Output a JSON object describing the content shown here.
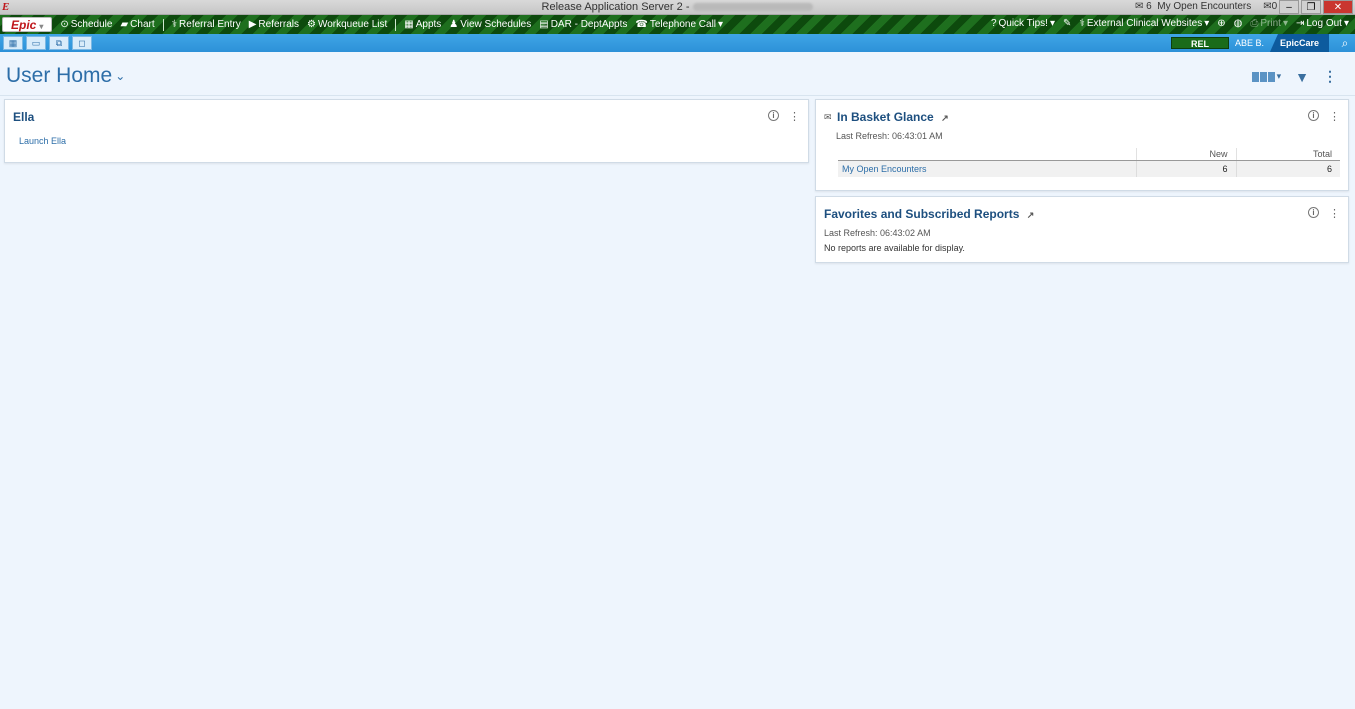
{
  "window": {
    "title": "Release Application Server 2 -",
    "notif_count": "6",
    "notif_label": "My Open Encounters",
    "mail_count": "0"
  },
  "toolbar": {
    "logo": "Epic",
    "items": [
      {
        "label": "Schedule",
        "icon": "clock-icon"
      },
      {
        "label": "Chart",
        "icon": "folder-icon"
      },
      {
        "label": "Referral Entry",
        "icon": "referral-entry-icon"
      },
      {
        "label": "Referrals",
        "icon": "arrow-right-icon"
      },
      {
        "label": "Workqueue List",
        "icon": "workqueue-icon"
      },
      {
        "label": "Appts",
        "icon": "appts-icon"
      },
      {
        "label": "View Schedules",
        "icon": "people-icon"
      },
      {
        "label": "DAR - DeptAppts",
        "icon": "document-icon"
      },
      {
        "label": "Telephone Call",
        "icon": "phone-icon"
      }
    ],
    "right_items": [
      {
        "label": "Quick Tips!"
      },
      {
        "label": "External Clinical Websites"
      },
      {
        "label": "Print"
      },
      {
        "label": "Log Out"
      }
    ]
  },
  "subbar": {
    "environment": "REL",
    "user": "ABE B.",
    "product": "EpicCare"
  },
  "header": {
    "title": "User Home"
  },
  "ella": {
    "title": "Ella",
    "launch_label": "Launch Ella"
  },
  "inbasket": {
    "title": "In Basket Glance",
    "last_refresh": "Last Refresh: 06:43:01 AM",
    "columns": [
      "",
      "New",
      "Total"
    ],
    "rows": [
      {
        "name": "My Open Encounters",
        "new": "6",
        "total": "6"
      }
    ]
  },
  "reports": {
    "title": "Favorites and Subscribed Reports",
    "last_refresh": "Last Refresh: 06:43:02 AM",
    "empty_message": "No reports are available for display."
  },
  "colors": {
    "accent": "#2d6ea8",
    "toolbar_green": "#1e6f1e",
    "subbar_blue": "#2d91d8",
    "background": "#eef5fd"
  }
}
